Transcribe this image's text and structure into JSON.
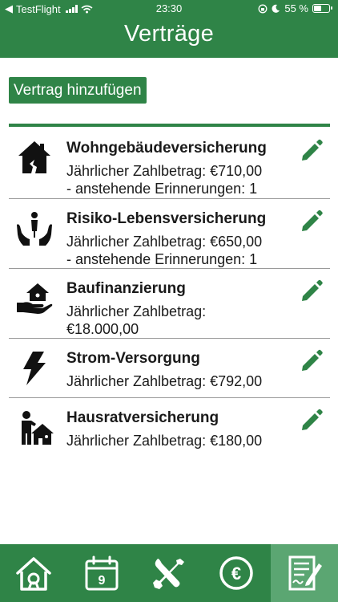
{
  "status": {
    "carrier": "TestFlight",
    "time": "23:30",
    "battery": "55 %",
    "battery_level": 0.55
  },
  "header": {
    "title": "Verträge"
  },
  "toolbar": {
    "add_label": "Vertrag hinzufügen"
  },
  "contracts": [
    {
      "icon": "house-icon",
      "name": "Wohngebäudeversicherung",
      "line1": "Jährlicher Zahlbetrag: €710,00",
      "line2": "- anstehende Erinnerungen: 1"
    },
    {
      "icon": "hands-person-icon",
      "name": "Risiko-Lebensversicherung",
      "line1": "Jährlicher Zahlbetrag: €650,00",
      "line2": "- anstehende Erinnerungen: 1"
    },
    {
      "icon": "hand-house-icon",
      "name": "Baufinanzierung",
      "line1": "Jährlicher Zahlbetrag:",
      "line2": "€18.000,00"
    },
    {
      "icon": "lightning-icon",
      "name": "Strom-Versorgung",
      "line1": "Jährlicher Zahlbetrag: €792,00",
      "line2": ""
    },
    {
      "icon": "person-house-icon",
      "name": "Hausratversicherung",
      "line1": "Jährlicher Zahlbetrag: €180,00",
      "line2": ""
    }
  ],
  "tabbar": {
    "tabs": [
      {
        "icon": "home-tab-icon",
        "active": false
      },
      {
        "icon": "calendar-tab-icon",
        "active": false,
        "day": "9"
      },
      {
        "icon": "tools-tab-icon",
        "active": false
      },
      {
        "icon": "euro-tab-icon",
        "active": false,
        "symbol": "€"
      },
      {
        "icon": "contract-tab-icon",
        "active": true
      }
    ]
  },
  "colors": {
    "brand": "#2f8447",
    "tab_active": "#5ba672",
    "divider": "#9a9a9a"
  }
}
